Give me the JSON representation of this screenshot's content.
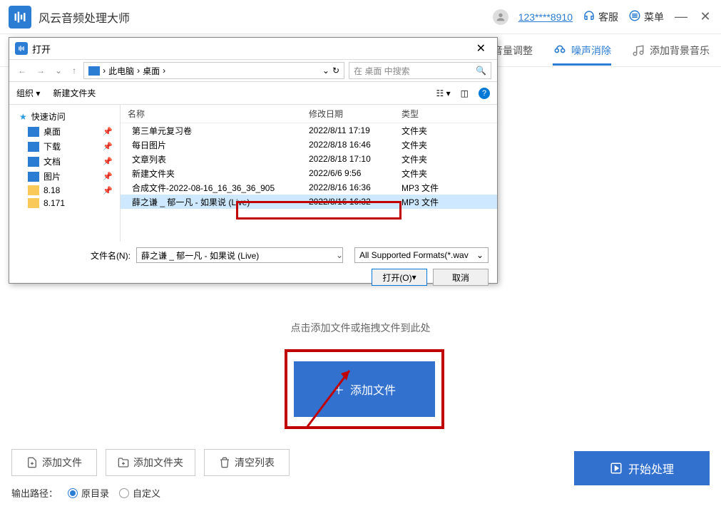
{
  "app": {
    "title": "风云音频处理大师",
    "username": "123****8910",
    "support": "客服",
    "menu": "菜单"
  },
  "tabs": {
    "volume": "音量调整",
    "noise": "噪声消除",
    "bgm": "添加背景音乐"
  },
  "main": {
    "drop_hint": "点击添加文件或拖拽文件到此处",
    "add_file": "添加文件"
  },
  "toolbar": {
    "add_file": "添加文件",
    "add_folder": "添加文件夹",
    "clear": "清空列表",
    "start": "开始处理"
  },
  "output": {
    "label": "输出路径：",
    "original": "原目录",
    "custom": "自定义"
  },
  "dialog": {
    "title": "打开",
    "path_pc": "此电脑",
    "path_desktop": "桌面",
    "search_placeholder": "在 桌面 中搜索",
    "organize": "组织",
    "new_folder": "新建文件夹",
    "col_name": "名称",
    "col_date": "修改日期",
    "col_type": "类型",
    "filename_label": "文件名(N):",
    "filename_value": "薛之谦 _ 郁一凡 - 如果说 (Live)",
    "format": "All Supported Formats(*.wav",
    "open_btn": "打开(O)",
    "cancel_btn": "取消",
    "sidebar": {
      "quick": "快速访问",
      "desktop": "桌面",
      "download": "下载",
      "doc": "文档",
      "pic": "图片",
      "f818": "8.18",
      "f8171": "8.171"
    },
    "files": [
      {
        "name": "第三单元复习卷",
        "date": "2022/8/11 17:19",
        "type": "文件夹",
        "icon": "folder"
      },
      {
        "name": "每日图片",
        "date": "2022/8/18 16:46",
        "type": "文件夹",
        "icon": "folder"
      },
      {
        "name": "文章列表",
        "date": "2022/8/18 17:10",
        "type": "文件夹",
        "icon": "folder"
      },
      {
        "name": "新建文件夹",
        "date": "2022/6/6 9:56",
        "type": "文件夹",
        "icon": "folder"
      },
      {
        "name": "合成文件-2022-08-16_16_36_36_905",
        "date": "2022/8/16 16:36",
        "type": "MP3 文件",
        "icon": "audio"
      },
      {
        "name": "薛之谦 _ 郁一凡 - 如果说 (Live)",
        "date": "2022/8/16 16:32",
        "type": "MP3 文件",
        "icon": "audio"
      }
    ]
  }
}
